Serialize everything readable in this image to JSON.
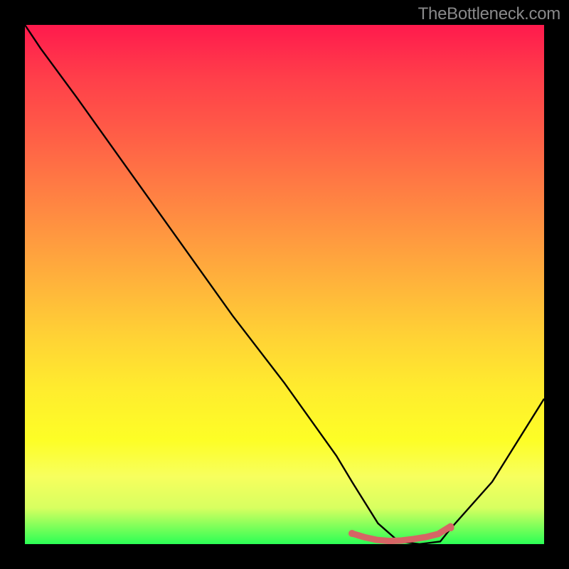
{
  "watermark": "TheBottleneck.com",
  "colors": {
    "background": "#000000",
    "gradient_top": "#ff1a4d",
    "gradient_bottom": "#2bff55",
    "curve_stroke": "#000000",
    "marker_stroke": "#d66565",
    "marker_fill": "#d66565"
  },
  "chart_data": {
    "type": "line",
    "title": "",
    "xlabel": "",
    "ylabel": "",
    "xlim": [
      0,
      100
    ],
    "ylim": [
      0,
      100
    ],
    "x": [
      0,
      3,
      10,
      20,
      30,
      40,
      50,
      60,
      63,
      68,
      72,
      76,
      80,
      82,
      90,
      100
    ],
    "values": [
      100,
      95.5,
      86,
      72,
      58,
      44,
      31,
      17,
      12,
      4,
      0.5,
      0,
      0.5,
      3,
      12,
      28
    ],
    "bottom_marker": {
      "x_start": 63,
      "x_end": 82,
      "y": 0
    },
    "annotations": [
      "TheBottleneck.com"
    ]
  }
}
